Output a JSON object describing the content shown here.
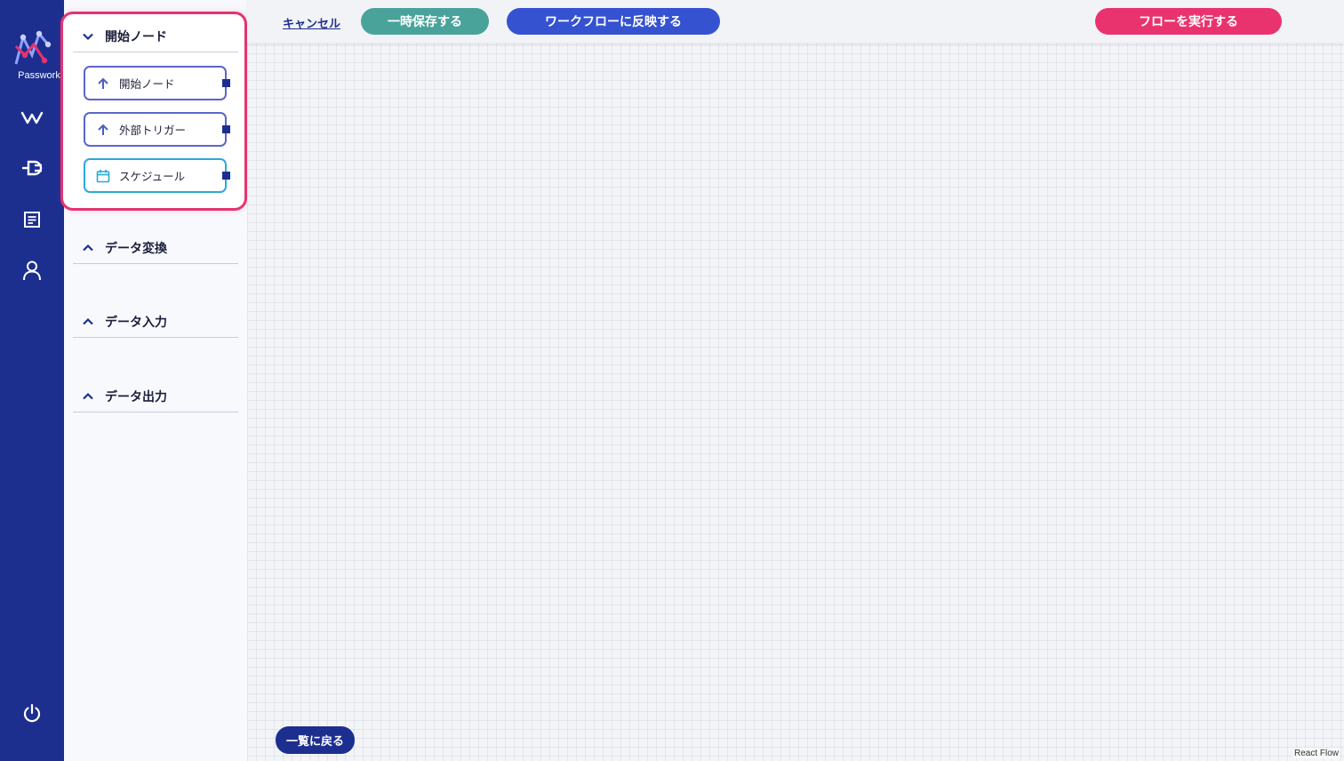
{
  "brand": {
    "name": "Passwork"
  },
  "rail": {
    "items": [
      {
        "icon": "workflow-icon"
      },
      {
        "icon": "plug-icon"
      },
      {
        "icon": "document-icon"
      },
      {
        "icon": "user-icon"
      }
    ],
    "footer_icon": "power-icon"
  },
  "palette": {
    "sections": [
      {
        "title": "開始ノード",
        "expanded": true,
        "items": [
          {
            "label": "開始ノード",
            "icon": "arrow-up-icon"
          },
          {
            "label": "外部トリガー",
            "icon": "arrow-up-icon"
          },
          {
            "label": "スケジュール",
            "icon": "calendar-icon"
          }
        ]
      },
      {
        "title": "データ変換",
        "expanded": false
      },
      {
        "title": "データ入力",
        "expanded": false
      },
      {
        "title": "データ出力",
        "expanded": false
      }
    ]
  },
  "toolbar": {
    "cancel_label": "キャンセル",
    "save_label": "一時保存する",
    "apply_label": "ワークフローに反映する",
    "run_label": "フローを実行する"
  },
  "canvas": {
    "back_label": "一覧に戻る",
    "attribution": "React Flow"
  },
  "colors": {
    "rail": "#1c2f8f",
    "highlight": "#e6336f",
    "save": "#4aa39b",
    "apply": "#3552d1",
    "run": "#e9336f"
  }
}
